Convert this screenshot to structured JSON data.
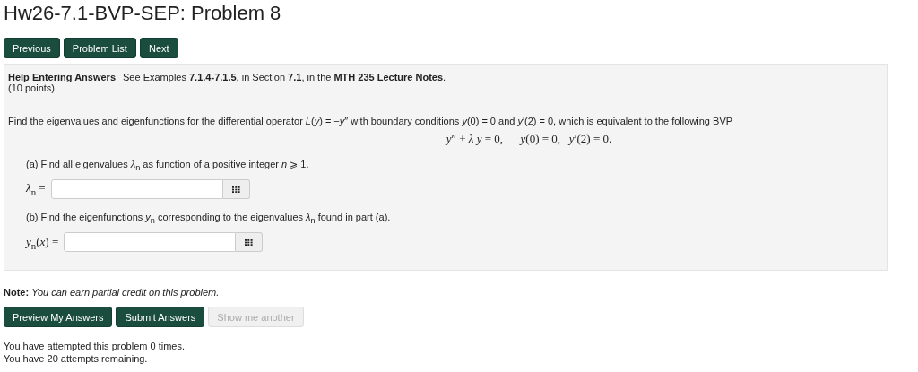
{
  "title": "Hw26-7.1-BVP-SEP: Problem 8",
  "nav_buttons": [
    {
      "label": "Previous"
    },
    {
      "label": "Problem List"
    },
    {
      "label": "Next"
    }
  ],
  "problem": {
    "help_link": "Help Entering Answers",
    "help_text": "See Examples **7.1.4-7.1.5**, in Section **7.1**, in the **MTH 235 Lecture Notes**.",
    "points": "(10 points)",
    "statement": "Find the eigenvalues and eigenfunctions for the differential operator *L*(*y*) = −*y*″ with boundary conditions *y*(0) = 0 and *y*′(2) = 0, which is equivalent to the following BVP",
    "equation": "*y*″ + *λ* *y* = 0,      *y*(0) = 0,   *y*′(2) = 0.",
    "parts": [
      {
        "prompt": "(a) Find all eigenvalues *λ*$_{n}$ as function of a positive integer *n* ⩾ 1.",
        "answer_label": "*λ*$_{n}$ ="
      },
      {
        "prompt": "(b) Find the eigenfunctions *y*$_{n}$ corresponding to the eigenvalues *λ*$_{n}$ found in part (a).",
        "answer_label": "*y*$_{n}$(*x*) ="
      }
    ]
  },
  "note_label": "Note:",
  "note_text": "You can earn partial credit on this problem.",
  "actions": [
    {
      "label": "Preview My Answers",
      "disabled": false
    },
    {
      "label": "Submit Answers",
      "disabled": false
    },
    {
      "label": "Show me another",
      "disabled": true
    }
  ],
  "status_lines": [
    "You have attempted this problem 0 times.",
    "You have 20 attempts remaining."
  ]
}
